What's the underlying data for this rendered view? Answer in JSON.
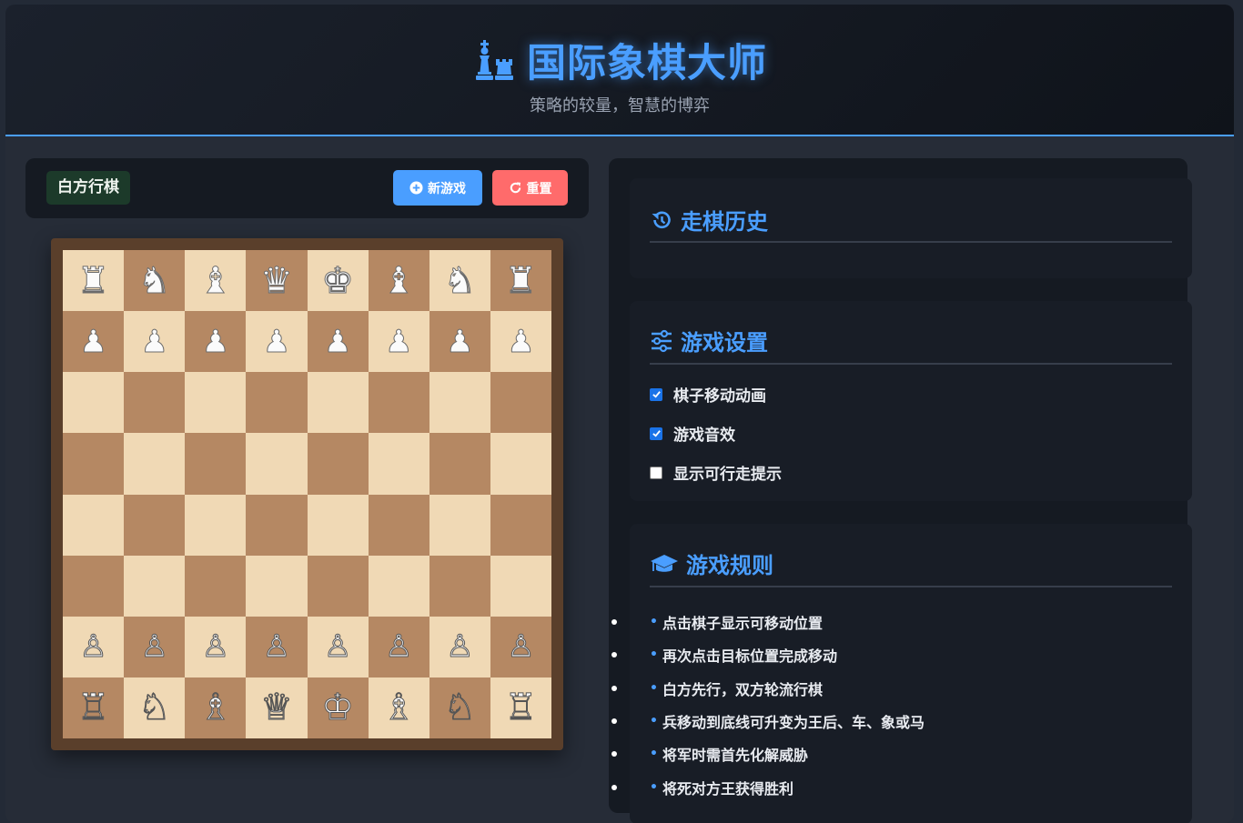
{
  "header": {
    "title": "国际象棋大师",
    "subtitle": "策略的较量，智慧的博弈",
    "icon": "chess-icon"
  },
  "controls": {
    "turn": "白方行棋",
    "new_game": "新游戏",
    "reset": "重置"
  },
  "board": {
    "light_color": "#f0d9b5",
    "dark_color": "#b58863",
    "rows": [
      [
        "♜",
        "♞",
        "♝",
        "♛",
        "♚",
        "♝",
        "♞",
        "♜"
      ],
      [
        "♟",
        "♟",
        "♟",
        "♟",
        "♟",
        "♟",
        "♟",
        "♟"
      ],
      [
        "",
        "",
        "",
        "",
        "",
        "",
        "",
        ""
      ],
      [
        "",
        "",
        "",
        "",
        "",
        "",
        "",
        ""
      ],
      [
        "",
        "",
        "",
        "",
        "",
        "",
        "",
        ""
      ],
      [
        "",
        "",
        "",
        "",
        "",
        "",
        "",
        ""
      ],
      [
        "♙",
        "♙",
        "♙",
        "♙",
        "♙",
        "♙",
        "♙",
        "♙"
      ],
      [
        "♖",
        "♘",
        "♗",
        "♕",
        "♔",
        "♗",
        "♘",
        "♖"
      ]
    ]
  },
  "history": {
    "title": "走棋历史",
    "icon": "history-icon"
  },
  "settings": {
    "title": "游戏设置",
    "icon": "sliders-icon",
    "options": [
      {
        "label": "棋子移动动画",
        "checked": true
      },
      {
        "label": "游戏音效",
        "checked": true
      },
      {
        "label": "显示可行走提示",
        "checked": false
      }
    ]
  },
  "rules": {
    "title": "游戏规则",
    "icon": "graduation-cap-icon",
    "items": [
      "点击棋子显示可移动位置",
      "再次点击目标位置完成移动",
      "白方先行，双方轮流行棋",
      "兵移动到底线可升变为王后、车、象或马",
      "将军时需首先化解威胁",
      "将死对方王获得胜利"
    ]
  },
  "colors": {
    "accent": "#4a9eff",
    "danger": "#ff6b6b",
    "turn_badge": "#1c3a2a"
  }
}
